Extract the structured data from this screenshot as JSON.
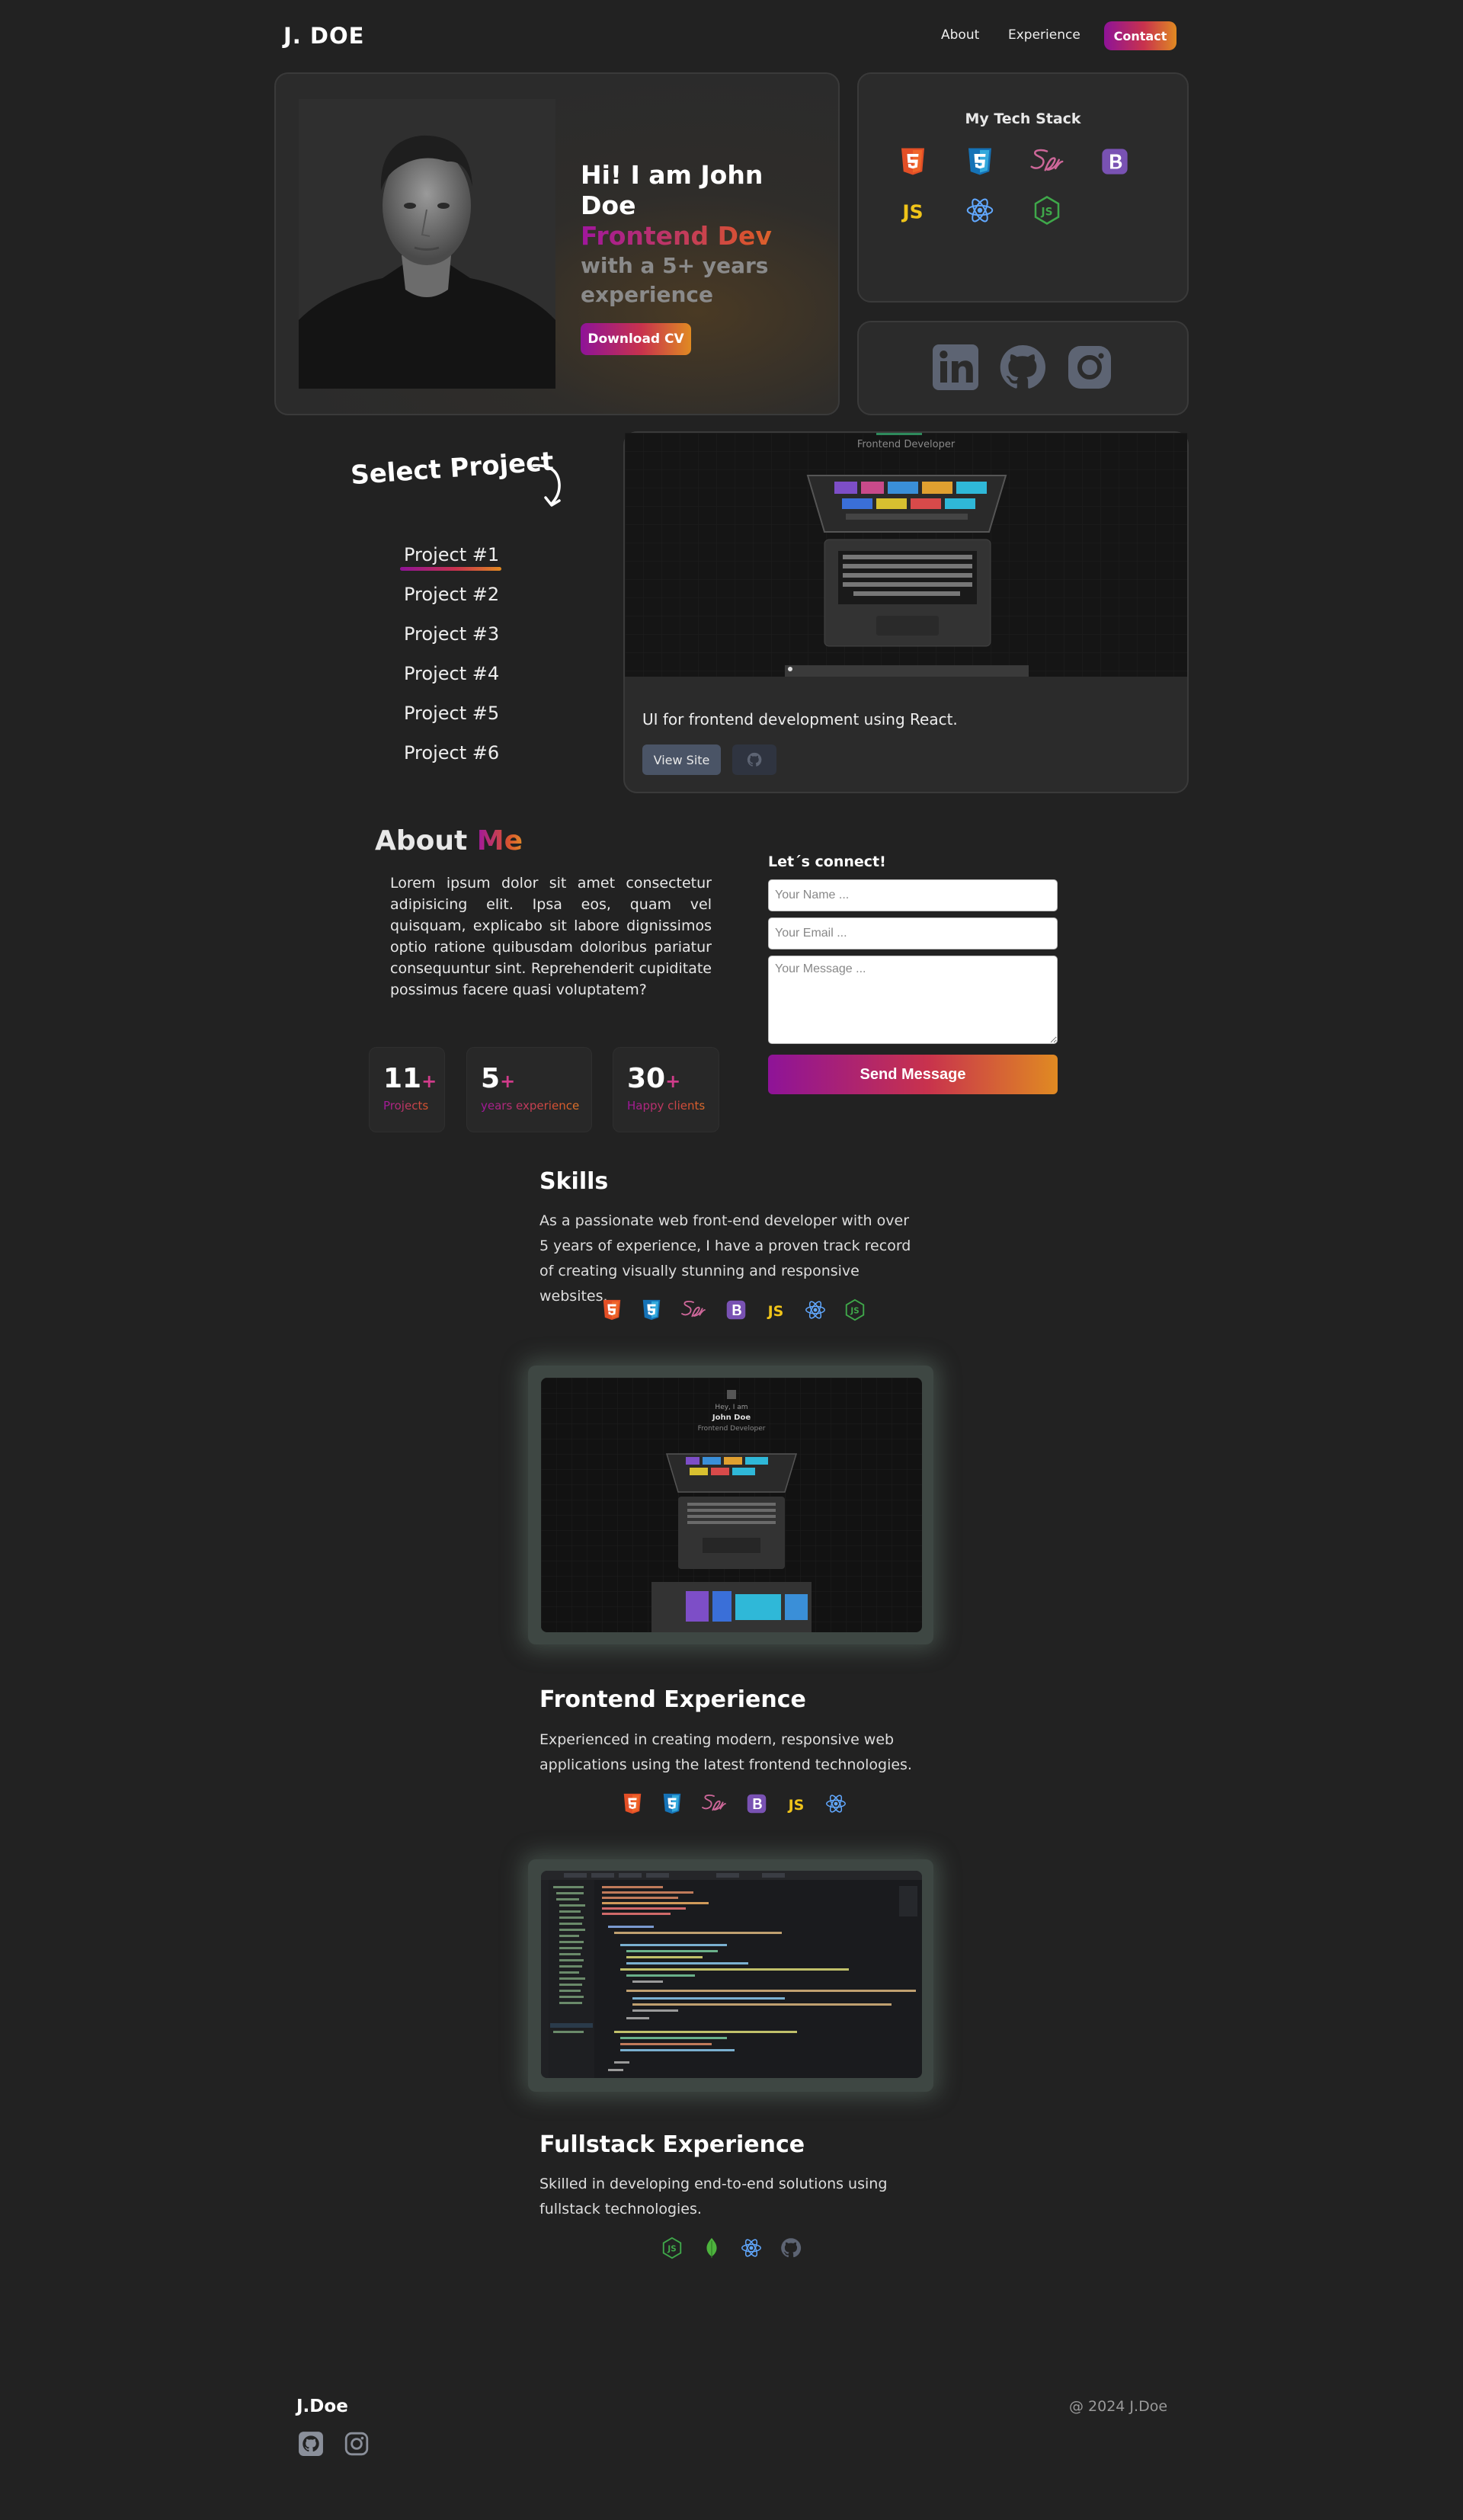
{
  "nav": {
    "logo": "J. DOE",
    "links": [
      "About",
      "Experience"
    ],
    "contact_label": "Contact"
  },
  "hero": {
    "greeting": "Hi! I am John Doe",
    "role": "Frontend Dev",
    "tagline": "with a 5+ years experience",
    "cv_label": "Download CV"
  },
  "tech_stack": {
    "title": "My Tech Stack",
    "icons": [
      "html5-icon",
      "css3-icon",
      "sass-icon",
      "bootstrap-icon",
      "javascript-icon",
      "react-icon",
      "nodejs-icon"
    ]
  },
  "social": {
    "icons": [
      "linkedin-icon",
      "github-icon",
      "instagram-icon"
    ]
  },
  "projects": {
    "heading": "Select Project",
    "items": [
      "Project #1",
      "Project #2",
      "Project #3",
      "Project #4",
      "Project #5",
      "Project #6"
    ],
    "active_index": 0,
    "preview_caption": "Frontend Developer",
    "description": "UI for frontend development using React.",
    "view_label": "View Site"
  },
  "about": {
    "title_part1": "About",
    "title_part2": "Me",
    "text": "Lorem ipsum dolor sit amet consectetur adipisicing elit. Ipsa eos, quam vel quisquam, explicabo sit labore dignissimos optio ratione quibusdam doloribus pariatur consequuntur sint. Reprehenderit cupiditate possimus facere quasi voluptatem?",
    "stats": [
      {
        "num": "11",
        "plus": "+",
        "label": "Projects"
      },
      {
        "num": "5",
        "plus": "+",
        "label": "years experience"
      },
      {
        "num": "30",
        "plus": "+",
        "label": "Happy clients"
      }
    ]
  },
  "contact_form": {
    "title": "Let´s connect!",
    "name_placeholder": "Your Name ...",
    "email_placeholder": "Your Email ...",
    "message_placeholder": "Your Message ...",
    "send_label": "Send Message"
  },
  "skills": {
    "title": "Skills",
    "text": "As a passionate web front-end developer with over 5 years of experience, I have a proven track record of creating visually stunning and responsive websites."
  },
  "screenshot1": {
    "line1": "Hey, I am",
    "line2": "John Doe",
    "line3": "Frontend Developer"
  },
  "frontend_exp": {
    "title": "Frontend Experience",
    "text": "Experienced in creating modern, responsive web applications using the latest frontend technologies."
  },
  "fullstack_exp": {
    "title": "Fullstack Experience",
    "text": "Skilled in developing end-to-end solutions using fullstack technologies."
  },
  "footer": {
    "logo": "J.Doe",
    "copyright": "@ 2024 J.Doe"
  },
  "colors": {
    "background": "#222222",
    "accent_start": "#8e1398",
    "accent_end": "#e08a22"
  }
}
